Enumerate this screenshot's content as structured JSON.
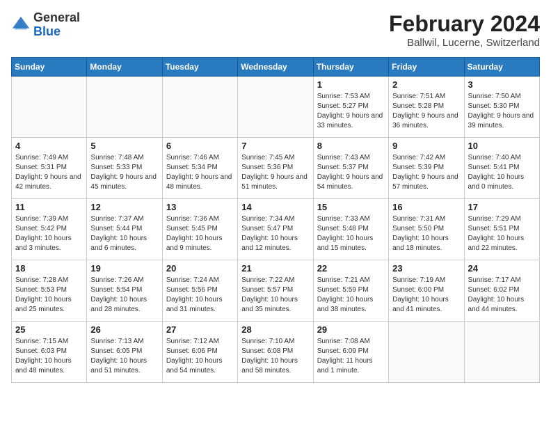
{
  "header": {
    "logo_general": "General",
    "logo_blue": "Blue",
    "month_year": "February 2024",
    "location": "Ballwil, Lucerne, Switzerland"
  },
  "weekdays": [
    "Sunday",
    "Monday",
    "Tuesday",
    "Wednesday",
    "Thursday",
    "Friday",
    "Saturday"
  ],
  "weeks": [
    [
      {
        "day": "",
        "empty": true
      },
      {
        "day": "",
        "empty": true
      },
      {
        "day": "",
        "empty": true
      },
      {
        "day": "",
        "empty": true
      },
      {
        "day": "1",
        "sunrise": "7:53 AM",
        "sunset": "5:27 PM",
        "daylight": "9 hours and 33 minutes."
      },
      {
        "day": "2",
        "sunrise": "7:51 AM",
        "sunset": "5:28 PM",
        "daylight": "9 hours and 36 minutes."
      },
      {
        "day": "3",
        "sunrise": "7:50 AM",
        "sunset": "5:30 PM",
        "daylight": "9 hours and 39 minutes."
      }
    ],
    [
      {
        "day": "4",
        "sunrise": "7:49 AM",
        "sunset": "5:31 PM",
        "daylight": "9 hours and 42 minutes."
      },
      {
        "day": "5",
        "sunrise": "7:48 AM",
        "sunset": "5:33 PM",
        "daylight": "9 hours and 45 minutes."
      },
      {
        "day": "6",
        "sunrise": "7:46 AM",
        "sunset": "5:34 PM",
        "daylight": "9 hours and 48 minutes."
      },
      {
        "day": "7",
        "sunrise": "7:45 AM",
        "sunset": "5:36 PM",
        "daylight": "9 hours and 51 minutes."
      },
      {
        "day": "8",
        "sunrise": "7:43 AM",
        "sunset": "5:37 PM",
        "daylight": "9 hours and 54 minutes."
      },
      {
        "day": "9",
        "sunrise": "7:42 AM",
        "sunset": "5:39 PM",
        "daylight": "9 hours and 57 minutes."
      },
      {
        "day": "10",
        "sunrise": "7:40 AM",
        "sunset": "5:41 PM",
        "daylight": "10 hours and 0 minutes."
      }
    ],
    [
      {
        "day": "11",
        "sunrise": "7:39 AM",
        "sunset": "5:42 PM",
        "daylight": "10 hours and 3 minutes."
      },
      {
        "day": "12",
        "sunrise": "7:37 AM",
        "sunset": "5:44 PM",
        "daylight": "10 hours and 6 minutes."
      },
      {
        "day": "13",
        "sunrise": "7:36 AM",
        "sunset": "5:45 PM",
        "daylight": "10 hours and 9 minutes."
      },
      {
        "day": "14",
        "sunrise": "7:34 AM",
        "sunset": "5:47 PM",
        "daylight": "10 hours and 12 minutes."
      },
      {
        "day": "15",
        "sunrise": "7:33 AM",
        "sunset": "5:48 PM",
        "daylight": "10 hours and 15 minutes."
      },
      {
        "day": "16",
        "sunrise": "7:31 AM",
        "sunset": "5:50 PM",
        "daylight": "10 hours and 18 minutes."
      },
      {
        "day": "17",
        "sunrise": "7:29 AM",
        "sunset": "5:51 PM",
        "daylight": "10 hours and 22 minutes."
      }
    ],
    [
      {
        "day": "18",
        "sunrise": "7:28 AM",
        "sunset": "5:53 PM",
        "daylight": "10 hours and 25 minutes."
      },
      {
        "day": "19",
        "sunrise": "7:26 AM",
        "sunset": "5:54 PM",
        "daylight": "10 hours and 28 minutes."
      },
      {
        "day": "20",
        "sunrise": "7:24 AM",
        "sunset": "5:56 PM",
        "daylight": "10 hours and 31 minutes."
      },
      {
        "day": "21",
        "sunrise": "7:22 AM",
        "sunset": "5:57 PM",
        "daylight": "10 hours and 35 minutes."
      },
      {
        "day": "22",
        "sunrise": "7:21 AM",
        "sunset": "5:59 PM",
        "daylight": "10 hours and 38 minutes."
      },
      {
        "day": "23",
        "sunrise": "7:19 AM",
        "sunset": "6:00 PM",
        "daylight": "10 hours and 41 minutes."
      },
      {
        "day": "24",
        "sunrise": "7:17 AM",
        "sunset": "6:02 PM",
        "daylight": "10 hours and 44 minutes."
      }
    ],
    [
      {
        "day": "25",
        "sunrise": "7:15 AM",
        "sunset": "6:03 PM",
        "daylight": "10 hours and 48 minutes."
      },
      {
        "day": "26",
        "sunrise": "7:13 AM",
        "sunset": "6:05 PM",
        "daylight": "10 hours and 51 minutes."
      },
      {
        "day": "27",
        "sunrise": "7:12 AM",
        "sunset": "6:06 PM",
        "daylight": "10 hours and 54 minutes."
      },
      {
        "day": "28",
        "sunrise": "7:10 AM",
        "sunset": "6:08 PM",
        "daylight": "10 hours and 58 minutes."
      },
      {
        "day": "29",
        "sunrise": "7:08 AM",
        "sunset": "6:09 PM",
        "daylight": "11 hours and 1 minute."
      },
      {
        "day": "",
        "empty": true
      },
      {
        "day": "",
        "empty": true
      }
    ]
  ]
}
